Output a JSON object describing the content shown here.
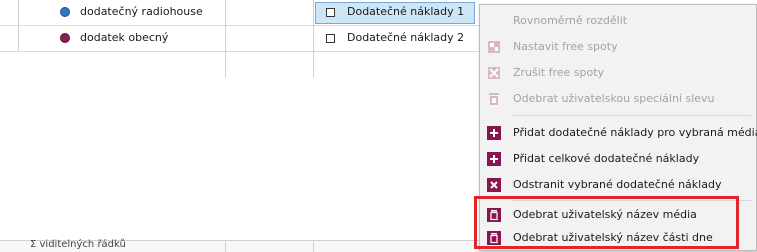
{
  "grid": {
    "rows": [
      {
        "media": "dodatečný radiohouse",
        "cost_item": "Dodatečné náklady 1",
        "dot_color": "#2f75c9",
        "selected": true
      },
      {
        "media": "dodatek obecný",
        "cost_item": "Dodatečné náklady 2",
        "dot_color": "#8a1e54",
        "selected": false
      }
    ],
    "footer_text": "Σ viditelných řádků"
  },
  "menu": {
    "items": [
      {
        "label": "Rovnoměrně rozdělit",
        "enabled": false,
        "icon": "none"
      },
      {
        "label": "Nastavit free spoty",
        "enabled": false,
        "icon": "free-spot-set-icon"
      },
      {
        "label": "Zrušit free spoty",
        "enabled": false,
        "icon": "free-spot-cancel-icon"
      },
      {
        "label": "Odebrat uživatelskou speciální slevu",
        "enabled": false,
        "icon": "trash-icon"
      },
      {
        "label": "Přidat dodatečné náklady pro vybraná média",
        "enabled": true,
        "icon": "plus-icon"
      },
      {
        "label": "Přidat celkové dodatečné náklady",
        "enabled": true,
        "icon": "plus-icon"
      },
      {
        "label": "Odstranit vybrané dodatečné náklady",
        "enabled": true,
        "icon": "x-icon"
      },
      {
        "label": "Odebrat uživatelský název média",
        "enabled": true,
        "icon": "trash-icon"
      },
      {
        "label": "Odebrat uživatelský název části dne",
        "enabled": true,
        "icon": "trash-icon"
      }
    ],
    "accent": "#8a1650",
    "highlight_color": "#e2242c"
  }
}
